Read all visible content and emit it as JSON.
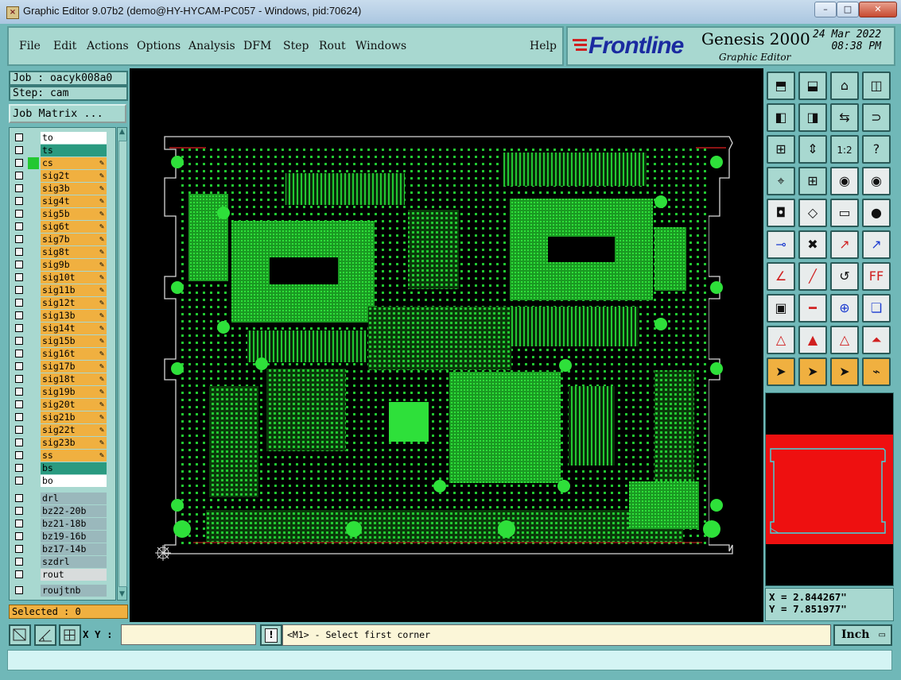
{
  "window": {
    "title": "Graphic Editor 9.07b2 (demo@HY-HYCAM-PC057 - Windows, pid:70624)",
    "minimize": "–",
    "maximize": "□",
    "close": "✕"
  },
  "menu": {
    "file": "File",
    "edit": "Edit",
    "actions": "Actions",
    "options": "Options",
    "analysis": "Analysis",
    "dfm": "DFM",
    "step": "Step",
    "rout": "Rout",
    "windows": "Windows",
    "help": "Help"
  },
  "brand": {
    "logo": "Frontline",
    "product": "Genesis 2000",
    "subtitle": "Graphic Editor",
    "date": "24 Mar 2022",
    "time": "08:38 PM"
  },
  "job": {
    "job_label": "Job : oacyk008a0",
    "step_label": "Step: cam",
    "matrix_button": "Job Matrix ..."
  },
  "layers": [
    {
      "name": "to",
      "style": "white",
      "pen": false,
      "mark": ""
    },
    {
      "name": "ts",
      "style": "teal",
      "pen": false,
      "mark": ""
    },
    {
      "name": "cs",
      "style": "orange",
      "pen": true,
      "mark": "green"
    },
    {
      "name": "sig2t",
      "style": "orange",
      "pen": true,
      "mark": ""
    },
    {
      "name": "sig3b",
      "style": "orange",
      "pen": true,
      "mark": ""
    },
    {
      "name": "sig4t",
      "style": "orange",
      "pen": true,
      "mark": ""
    },
    {
      "name": "sig5b",
      "style": "orange",
      "pen": true,
      "mark": ""
    },
    {
      "name": "sig6t",
      "style": "orange",
      "pen": true,
      "mark": ""
    },
    {
      "name": "sig7b",
      "style": "orange",
      "pen": true,
      "mark": ""
    },
    {
      "name": "sig8t",
      "style": "orange",
      "pen": true,
      "mark": ""
    },
    {
      "name": "sig9b",
      "style": "orange",
      "pen": true,
      "mark": ""
    },
    {
      "name": "sig10t",
      "style": "orange",
      "pen": true,
      "mark": ""
    },
    {
      "name": "sig11b",
      "style": "orange",
      "pen": true,
      "mark": ""
    },
    {
      "name": "sig12t",
      "style": "orange",
      "pen": true,
      "mark": ""
    },
    {
      "name": "sig13b",
      "style": "orange",
      "pen": true,
      "mark": ""
    },
    {
      "name": "sig14t",
      "style": "orange",
      "pen": true,
      "mark": ""
    },
    {
      "name": "sig15b",
      "style": "orange",
      "pen": true,
      "mark": ""
    },
    {
      "name": "sig16t",
      "style": "orange",
      "pen": true,
      "mark": ""
    },
    {
      "name": "sig17b",
      "style": "orange",
      "pen": true,
      "mark": ""
    },
    {
      "name": "sig18t",
      "style": "orange",
      "pen": true,
      "mark": ""
    },
    {
      "name": "sig19b",
      "style": "orange",
      "pen": true,
      "mark": ""
    },
    {
      "name": "sig20t",
      "style": "orange",
      "pen": true,
      "mark": ""
    },
    {
      "name": "sig21b",
      "style": "orange",
      "pen": true,
      "mark": ""
    },
    {
      "name": "sig22t",
      "style": "orange",
      "pen": true,
      "mark": ""
    },
    {
      "name": "sig23b",
      "style": "orange",
      "pen": true,
      "mark": ""
    },
    {
      "name": "ss",
      "style": "orange",
      "pen": true,
      "mark": ""
    },
    {
      "name": "bs",
      "style": "teal",
      "pen": false,
      "mark": ""
    },
    {
      "name": "bo",
      "style": "white",
      "pen": false,
      "mark": ""
    },
    {
      "name": "drl",
      "style": "gray",
      "pen": false,
      "mark": ""
    },
    {
      "name": "bz22-20b",
      "style": "gray",
      "pen": false,
      "mark": ""
    },
    {
      "name": "bz21-18b",
      "style": "gray",
      "pen": false,
      "mark": ""
    },
    {
      "name": "bz19-16b",
      "style": "gray",
      "pen": false,
      "mark": ""
    },
    {
      "name": "bz17-14b",
      "style": "gray",
      "pen": false,
      "mark": ""
    },
    {
      "name": "szdrl",
      "style": "gray",
      "pen": false,
      "mark": ""
    },
    {
      "name": "rout",
      "style": "lightgray",
      "pen": false,
      "mark": ""
    },
    {
      "name": "roujtnb",
      "style": "gray",
      "pen": false,
      "mark": ""
    }
  ],
  "layer_colors": {
    "white": "#ffffff",
    "teal": "#2a9a80",
    "orange": "#f0b040",
    "gray": "#9ab8bc",
    "lightgray": "#d8dcdc"
  },
  "selected": "Selected : 0",
  "coords": {
    "x": "X = 2.844267\"",
    "y": "Y = 7.851977\""
  },
  "bottom": {
    "xy_label": "X Y :",
    "xy_value": "",
    "exclaim": "!",
    "message": "<M1> - Select first corner",
    "units": "Inch"
  },
  "colors": {
    "frame": "#70b8b8",
    "panel": "#a8d8d0",
    "copper": "#22c832",
    "preview_fill": "#ee1010"
  }
}
